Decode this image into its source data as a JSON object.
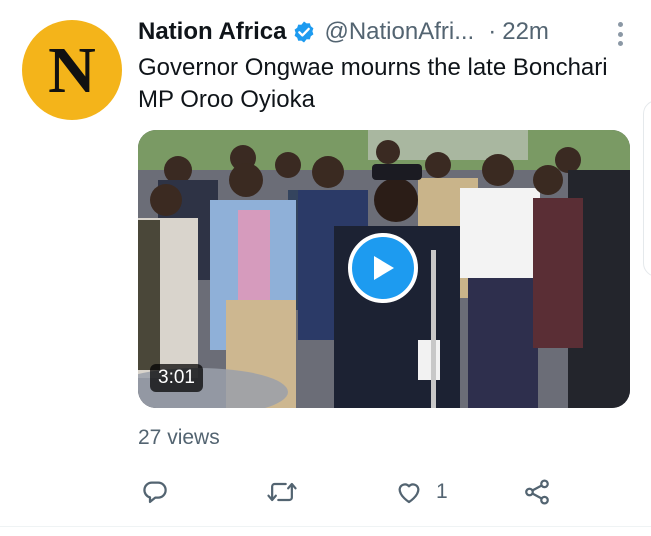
{
  "tweet": {
    "avatar_letter": "N",
    "author_name": "Nation Africa",
    "handle": "@NationAfri...",
    "separator": "·",
    "time": "22m",
    "text": "Governor Ongwae mourns the late Bonchari MP Oroo Oyioka",
    "video_duration": "3:01",
    "views": "27 views",
    "like_count": "1"
  },
  "colors": {
    "avatar_bg": "#f4b41a",
    "verified": "#1d9bf0",
    "play_button": "#1d9bf0",
    "secondary_text": "#536471"
  },
  "icons": {
    "more": "more-vertical-icon",
    "verified": "verified-badge-icon",
    "play": "play-icon",
    "reply": "reply-icon",
    "retweet": "retweet-icon",
    "like": "heart-icon",
    "share": "share-icon"
  }
}
